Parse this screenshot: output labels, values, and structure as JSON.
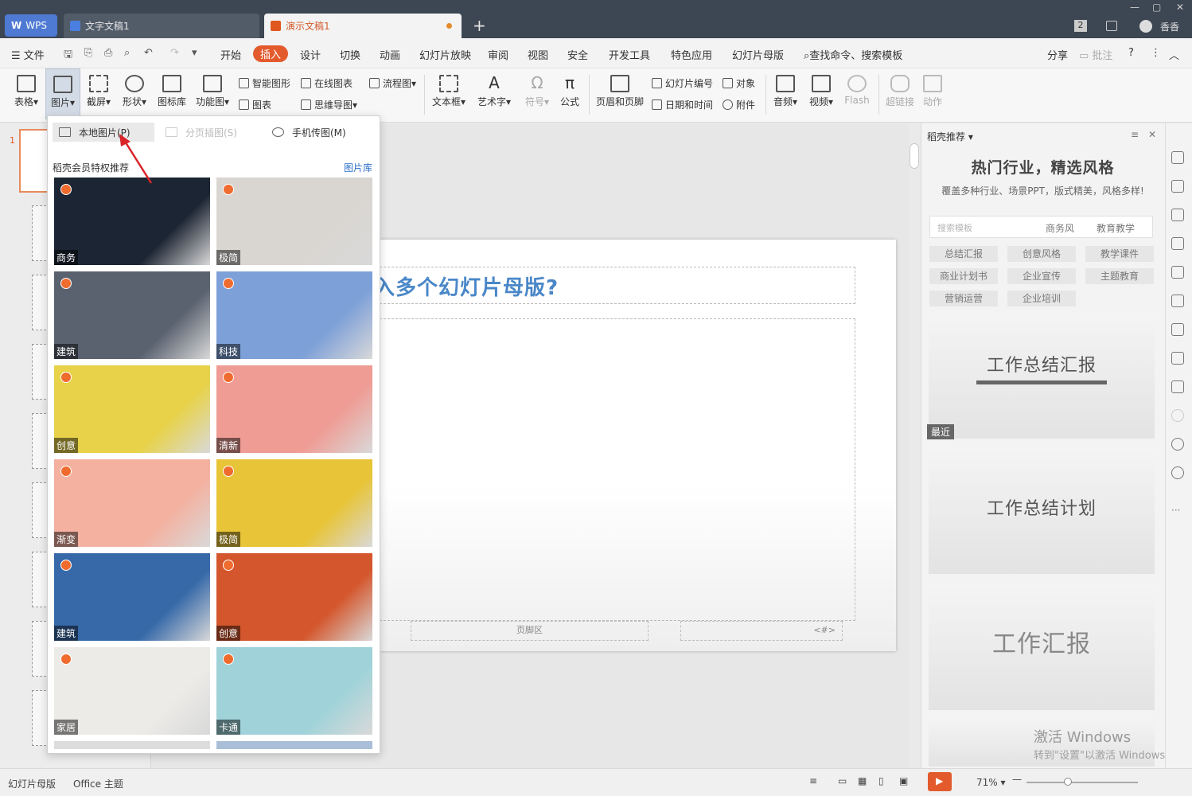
{
  "titlebar": {
    "wps_tab": "WPS",
    "doc_tab": "文字文稿1",
    "ppt_tab": "演示文稿1",
    "new_tab": "+",
    "badge": "2",
    "user_name": "香香"
  },
  "menu": {
    "file": "文件",
    "items": [
      "开始",
      "插入",
      "设计",
      "切换",
      "动画",
      "幻灯片放映",
      "审阅",
      "视图",
      "安全",
      "开发工具",
      "特色应用",
      "幻灯片母版"
    ],
    "search": "查找命令、搜索模板",
    "share": "分享",
    "comment": "批注",
    "help": "?"
  },
  "ribbon": {
    "table": "表格",
    "picture": "图片",
    "screenshot": "截屏",
    "shape": "形状",
    "icon_lib": "图标库",
    "func_chart": "功能图",
    "smart_shape": "智能图形",
    "chart": "图表",
    "online_chart": "在线图表",
    "mind_map": "思维导图",
    "flowchart": "流程图",
    "textbox": "文本框",
    "wordart": "艺术字",
    "symbol": "符号",
    "formula": "公式",
    "header_footer": "页眉和页脚",
    "slide_number": "幻灯片编号",
    "date_time": "日期和时间",
    "object": "对象",
    "attachment": "附件",
    "audio": "音频",
    "video": "视频",
    "flash": "Flash",
    "hyperlink": "超链接",
    "action": "动作"
  },
  "dropdown": {
    "local_picture": "本地图片(P)",
    "page_picture": "分页插图(S)",
    "phone_picture": "手机传图(M)",
    "section": "稻壳会员特权推荐",
    "library_link": "图片库",
    "photos": [
      {
        "label": "商务",
        "color": "#1c2533"
      },
      {
        "label": "极简",
        "color": "#d9d6d2"
      },
      {
        "label": "建筑",
        "color": "#5a6270"
      },
      {
        "label": "科技",
        "color": "#7ea0d8"
      },
      {
        "label": "创意",
        "color": "#e7d24a"
      },
      {
        "label": "清新",
        "color": "#ef9c94"
      },
      {
        "label": "渐变",
        "color": "#f4b1a0"
      },
      {
        "label": "极简",
        "color": "#e8c438"
      },
      {
        "label": "建筑",
        "color": "#3769a8"
      },
      {
        "label": "创意",
        "color": "#d4562c"
      },
      {
        "label": "家居",
        "color": "#ecebe8"
      },
      {
        "label": "卡通",
        "color": "#9fd3d9"
      }
    ]
  },
  "slide": {
    "title": "入多个幻灯片母版?",
    "footer": "页脚区",
    "number": "<#>",
    "slide_index": "1"
  },
  "right_panel": {
    "header": "稻壳推荐",
    "title": "热门行业，精选风格",
    "subtitle": "覆盖多种行业、场景PPT，版式精美，风格多样!",
    "search_placeholder": "搜索模板",
    "search_tags": [
      "商务风",
      "教育教学"
    ],
    "chips": [
      "总结汇报",
      "创意风格",
      "教学课件",
      "商业计划书",
      "企业宣传",
      "主题教育",
      "营销运营",
      "企业培训"
    ],
    "cards": [
      "工作总结汇报",
      "工作总结计划",
      "工作汇报"
    ],
    "recent_tag": "最近",
    "watermark_line1": "激活 Windows",
    "watermark_line2": "转到\"设置\"以激活 Windows。"
  },
  "status": {
    "mode": "幻灯片母版",
    "theme": "Office 主题",
    "zoom": "71%"
  }
}
